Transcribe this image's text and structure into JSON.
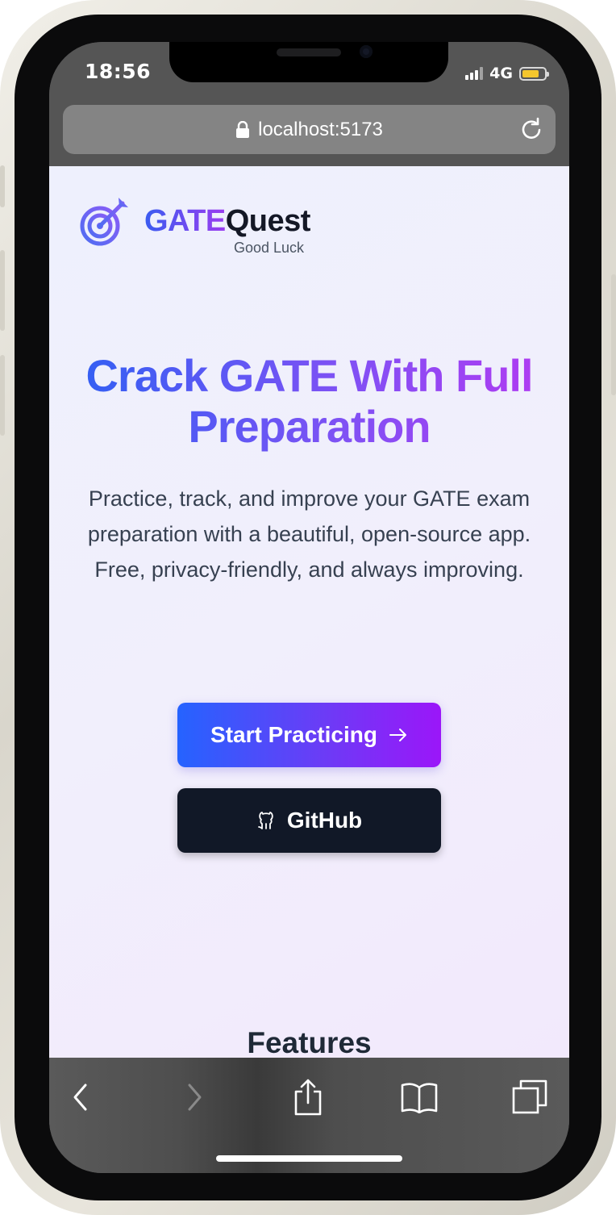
{
  "status_bar": {
    "time": "18:56",
    "network": "4G",
    "battery_level": 0.75,
    "signal_bars": 4
  },
  "browser": {
    "url": "localhost:5173",
    "icons": [
      "lock-icon",
      "reload-icon",
      "back-icon",
      "forward-icon",
      "share-icon",
      "bookmarks-icon",
      "tabs-icon"
    ]
  },
  "header": {
    "brand_part1": "GATE",
    "brand_part2": "Quest",
    "tagline": "Good Luck",
    "logo_icon": "target-arrow-icon"
  },
  "hero": {
    "title": "Crack GATE With Full Preparation",
    "subtitle": "Practice, track, and improve your GATE exam preparation with a beautiful, open-source app. Free, privacy-friendly, and always improving."
  },
  "buttons": {
    "start_label": "Start Practicing",
    "start_icon": "arrow-right-icon",
    "github_label": "GitHub",
    "github_icon": "github-icon"
  },
  "sections": {
    "features_title": "Features"
  },
  "colors": {
    "primary_gradient_start": "#2563ff",
    "primary_gradient_end": "#9b16f9",
    "dark_button": "#111827",
    "page_background": "#eef0fd"
  }
}
